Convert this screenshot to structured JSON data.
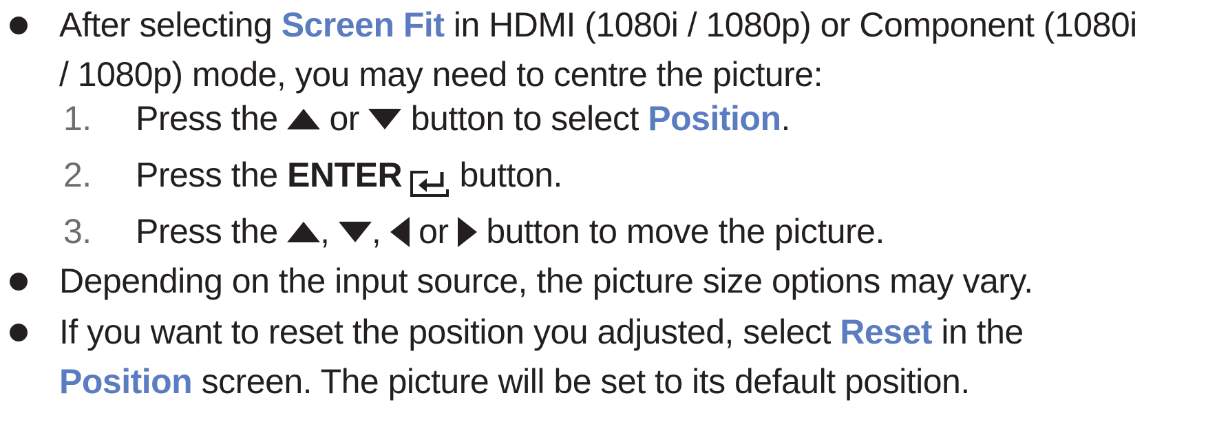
{
  "bullets": [
    {
      "lines": [
        {
          "parts": [
            {
              "text": "After selecting ",
              "style": "normal"
            },
            {
              "text": "Screen Fit",
              "style": "highlight"
            },
            {
              "text": " in HDMI (1080i / 1080p) or Component (1080i",
              "style": "normal"
            }
          ]
        },
        {
          "parts": [
            {
              "text": "/ 1080p) mode, you may need to centre the picture:",
              "style": "normal"
            }
          ]
        }
      ]
    },
    {
      "lines": [
        {
          "parts": [
            {
              "text": "Depending on the input source, the picture size options may vary.",
              "style": "normal"
            }
          ]
        }
      ]
    },
    {
      "lines": [
        {
          "parts": [
            {
              "text": "If you want to reset the position you adjusted, select ",
              "style": "normal"
            },
            {
              "text": "Reset",
              "style": "highlight"
            },
            {
              "text": " in the",
              "style": "normal"
            }
          ]
        },
        {
          "parts": [
            {
              "text": "Position",
              "style": "highlight"
            },
            {
              "text": " screen. The picture will be set to its default position.",
              "style": "normal"
            }
          ]
        }
      ]
    }
  ],
  "steps": [
    {
      "number": "1.",
      "parts": [
        {
          "text": "Press the ",
          "style": "normal"
        },
        {
          "icon": "up-arrow-icon"
        },
        {
          "text": " or ",
          "style": "normal"
        },
        {
          "icon": "down-arrow-icon"
        },
        {
          "text": " button to select ",
          "style": "normal"
        },
        {
          "text": "Position",
          "style": "highlight"
        },
        {
          "text": ".",
          "style": "normal"
        }
      ]
    },
    {
      "number": "2.",
      "parts": [
        {
          "text": "Press the ",
          "style": "normal"
        },
        {
          "text": "ENTER",
          "style": "strong"
        },
        {
          "icon": "enter-icon"
        },
        {
          "text": " button.",
          "style": "normal"
        }
      ]
    },
    {
      "number": "3.",
      "parts": [
        {
          "text": "Press the ",
          "style": "normal"
        },
        {
          "icon": "up-arrow-icon"
        },
        {
          "text": ", ",
          "style": "normal"
        },
        {
          "icon": "down-arrow-icon"
        },
        {
          "text": ", ",
          "style": "normal"
        },
        {
          "icon": "left-arrow-icon"
        },
        {
          "text": " or ",
          "style": "normal"
        },
        {
          "icon": "right-arrow-icon"
        },
        {
          "text": " button to move the picture.",
          "style": "normal"
        }
      ]
    }
  ],
  "colors": {
    "text": "#231f20",
    "highlight": "#5b7cc0",
    "step_number": "#6d6e71"
  }
}
